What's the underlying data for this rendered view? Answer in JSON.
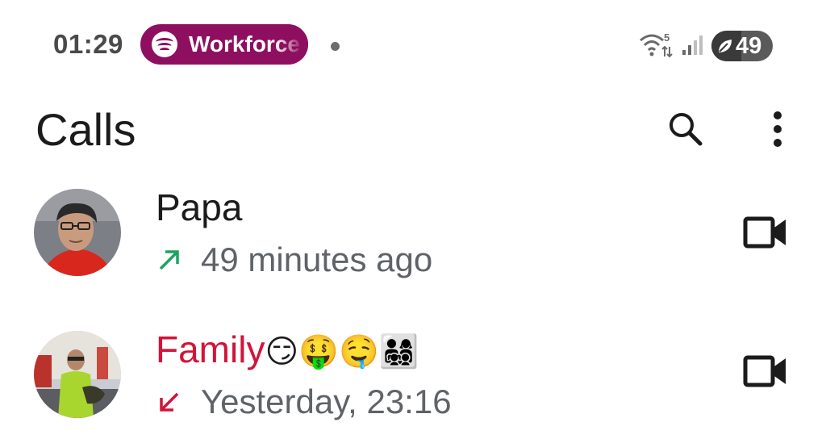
{
  "status_bar": {
    "time": "01:29",
    "media_app": "Workforce",
    "wifi_label": "5",
    "battery": "49",
    "battery_level": 0.49
  },
  "header": {
    "title": "Calls"
  },
  "calls": [
    {
      "name": "Papa",
      "direction": "outgoing",
      "direction_icon": "call-made-icon",
      "time": "49 minutes ago",
      "name_color": "#1b1b1b",
      "arrow_color": "#1ea362"
    },
    {
      "name": "Family",
      "emojis": "😏🤑🤤👨‍👩‍👧‍👦",
      "direction": "missed",
      "direction_icon": "call-missed-icon",
      "time": "Yesterday, 23:16",
      "name_color": "#d2143a",
      "arrow_color": "#d2143a"
    }
  ],
  "colors": {
    "media_pill": "#8e0f5f",
    "text_primary": "#1b1b1b",
    "text_secondary": "#5f6368",
    "outgoing": "#1ea362",
    "missed": "#d2143a"
  }
}
